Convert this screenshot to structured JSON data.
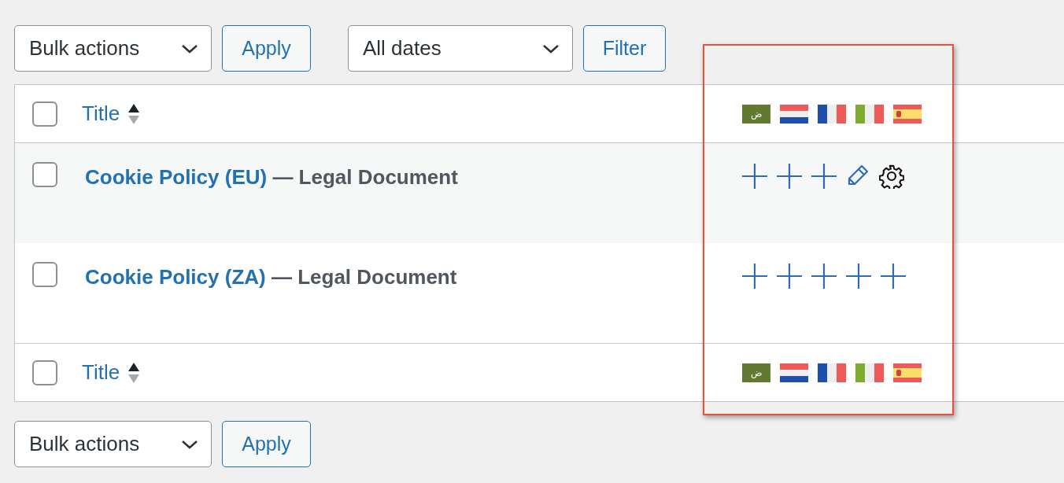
{
  "top_controls": {
    "bulk_actions": "Bulk actions",
    "apply": "Apply",
    "dates": "All dates",
    "filter": "Filter"
  },
  "table": {
    "header": {
      "checked": false,
      "title": "Title",
      "flags": [
        {
          "kind": "arabic",
          "text": "ض"
        },
        {
          "kind": "nl"
        },
        {
          "kind": "fr"
        },
        {
          "kind": "it"
        },
        {
          "kind": "es"
        }
      ]
    },
    "rows": [
      {
        "checked": false,
        "title": "Cookie Policy (EU)",
        "state": "— Legal Document",
        "actions": [
          {
            "kind": "add"
          },
          {
            "kind": "add"
          },
          {
            "kind": "add"
          },
          {
            "kind": "edit"
          },
          {
            "kind": "settings"
          }
        ]
      },
      {
        "checked": false,
        "title": "Cookie Policy (ZA)",
        "state": "— Legal Document",
        "actions": [
          {
            "kind": "add"
          },
          {
            "kind": "add"
          },
          {
            "kind": "add"
          },
          {
            "kind": "add"
          },
          {
            "kind": "add"
          }
        ]
      }
    ],
    "footer": {
      "checked": false,
      "title": "Title",
      "flags": [
        {
          "kind": "arabic",
          "text": "ض"
        },
        {
          "kind": "nl"
        },
        {
          "kind": "fr"
        },
        {
          "kind": "it"
        },
        {
          "kind": "es"
        }
      ]
    }
  },
  "bottom_controls": {
    "bulk_actions": "Bulk actions",
    "apply": "Apply"
  }
}
